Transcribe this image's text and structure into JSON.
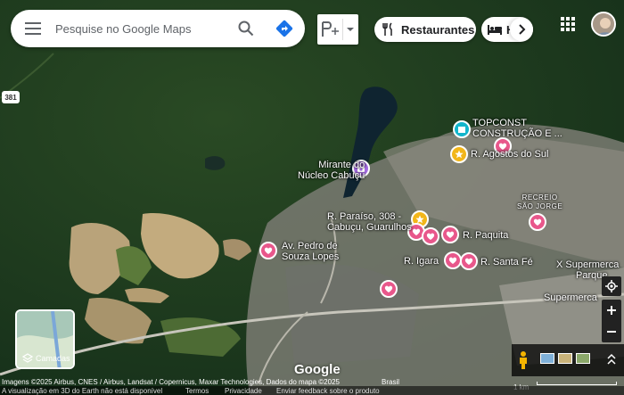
{
  "search": {
    "placeholder": "Pesquise no Google Maps"
  },
  "chips": {
    "restaurants": "Restaurantes",
    "hotels": "H"
  },
  "road_badge": "381",
  "places": [
    {
      "id": "topconst",
      "lines": [
        "TOPCONST",
        "CONSTRUÇÃO E ..."
      ]
    },
    {
      "id": "agostos",
      "lines": [
        "R. Agostos do Sul"
      ]
    },
    {
      "id": "mirante",
      "lines": [
        "Mirante do",
        "Núcleo Cabuçu"
      ]
    },
    {
      "id": "recreio",
      "lines": [
        "RECREIO",
        "SÃO JORGE"
      ]
    },
    {
      "id": "paraiso",
      "lines": [
        "R. Paraíso, 308 -",
        "Cabuçu, Guarulhos"
      ]
    },
    {
      "id": "paquita",
      "lines": [
        "R. Paquita"
      ]
    },
    {
      "id": "pedro",
      "lines": [
        "Av. Pedro de",
        "Souza Lopes"
      ]
    },
    {
      "id": "igara",
      "lines": [
        "R. Igara"
      ]
    },
    {
      "id": "santafe",
      "lines": [
        "R. Santa Fé"
      ]
    },
    {
      "id": "supermerca1",
      "lines": [
        "X Supermerca",
        "Parque"
      ]
    },
    {
      "id": "supermerca2",
      "lines": [
        "Supermerca"
      ]
    }
  ],
  "layers": {
    "label": "Camadas"
  },
  "footer": {
    "logo": "Google",
    "imagery": "Imagens ©2025 Airbus, CNES / Airbus, Landsat / Copernicus, Maxar Technologies, Dados do mapa ©2025",
    "country": "Brasil",
    "earth_note": "A visualização em 3D do Earth não está disponível",
    "terms": "Termos",
    "privacy": "Privacidade",
    "feedback": "Enviar feedback sobre o produto",
    "scale": "1 km"
  },
  "colors": {
    "heart": "#e8578b",
    "star": "#f2b61a",
    "teal": "#12b5cb",
    "purple": "#a36ae0",
    "directions": "#1a73e8"
  }
}
